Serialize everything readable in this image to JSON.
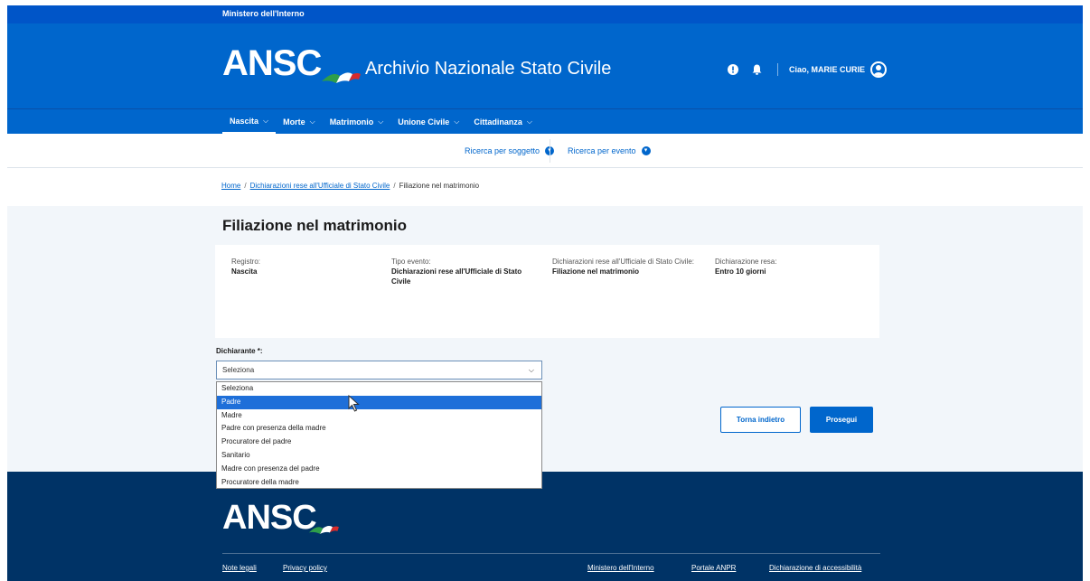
{
  "header": {
    "ministry": "Ministero dell'Interno",
    "logo_text": "ANSC",
    "app_title": "Archivio Nazionale Stato Civile",
    "user_greeting": "Ciao, MARIE CURIE"
  },
  "nav": {
    "items": [
      {
        "label": "Nascita",
        "active": true
      },
      {
        "label": "Morte",
        "active": false
      },
      {
        "label": "Matrimonio",
        "active": false
      },
      {
        "label": "Unione Civile",
        "active": false
      },
      {
        "label": "Cittadinanza",
        "active": false
      }
    ]
  },
  "subnav": {
    "search_subject": "Ricerca per soggetto",
    "search_event": "Ricerca per evento"
  },
  "breadcrumb": {
    "home": "Home",
    "section": "Dichiarazioni rese all'Ufficiale di Stato Civile",
    "current": "Filiazione nel matrimonio"
  },
  "page": {
    "title": "Filiazione nel matrimonio"
  },
  "info": {
    "registro_label": "Registro:",
    "registro_value": "Nascita",
    "tipo_label": "Tipo evento:",
    "tipo_value": "Dichiarazioni rese all'Ufficiale di Stato Civile",
    "dich_label": "Dichiarazioni rese all'Ufficiale di Stato Civile:",
    "dich_value": "Filiazione nel matrimonio",
    "resa_label": "Dichiarazione resa:",
    "resa_value": "Entro 10 giorni"
  },
  "form": {
    "dichiarante_label": "Dichiarante *:",
    "select_value": "Seleziona",
    "options": [
      "Seleziona",
      "Padre",
      "Madre",
      "Padre con presenza della madre",
      "Procuratore del padre",
      "Sanitario",
      "Madre con presenza del padre",
      "Procuratore della madre"
    ],
    "highlighted_option": "Padre"
  },
  "actions": {
    "back": "Torna indietro",
    "next": "Prosegui"
  },
  "footer": {
    "logo_text": "ANSC",
    "links": [
      "Note legali",
      "Privacy policy",
      "Ministero dell'Interno",
      "Portale ANPR",
      "Dichiarazione di accessibilità"
    ]
  },
  "colors": {
    "primary": "#0066cc",
    "footer_bg": "#003366",
    "highlight": "#1e6fd9"
  }
}
